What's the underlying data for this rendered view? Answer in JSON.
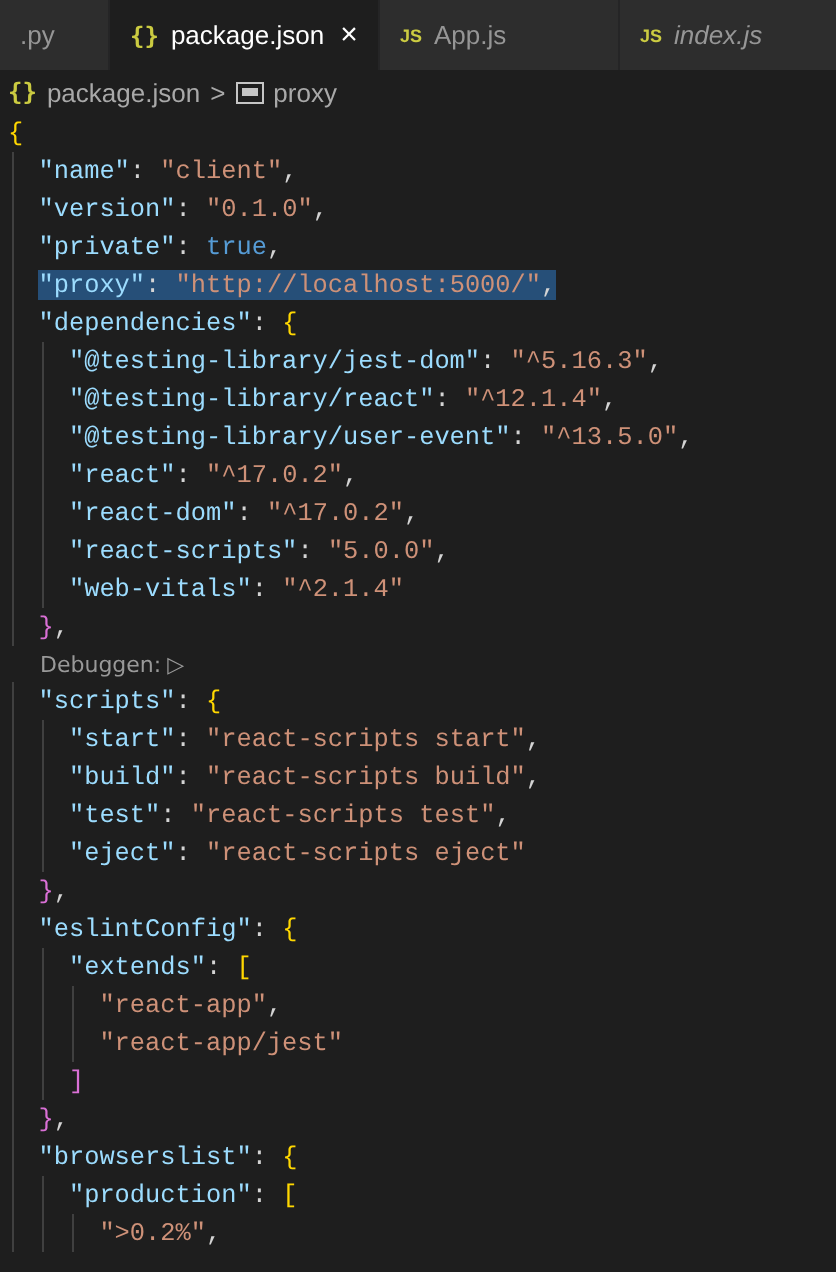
{
  "tabs": [
    {
      "label": ".py",
      "kind": "plain",
      "selected": false,
      "preview": false
    },
    {
      "label": "package.json",
      "kind": "json",
      "icon": "{}",
      "selected": true,
      "preview": false,
      "close": "×"
    },
    {
      "label": "App.js",
      "kind": "js",
      "icon": "JS",
      "selected": false,
      "preview": false
    },
    {
      "label": "index.js",
      "kind": "js",
      "icon": "JS",
      "selected": false,
      "preview": true
    }
  ],
  "breadcrumb": {
    "icon": "{}",
    "file": "package.json",
    "separator": ">",
    "symbol": "proxy"
  },
  "lines": [
    {
      "kind": "code",
      "text": "{",
      "selected": false
    },
    {
      "kind": "code",
      "text": "  \"name\": \"client\",",
      "selected": false
    },
    {
      "kind": "code",
      "text": "  \"version\": \"0.1.0\",",
      "selected": false
    },
    {
      "kind": "code",
      "text": "  \"private\": true,",
      "selected": false
    },
    {
      "kind": "code",
      "text": "  \"proxy\": \"http://localhost:5000/\",",
      "selected": true
    },
    {
      "kind": "code",
      "text": "  \"dependencies\": {",
      "selected": false
    },
    {
      "kind": "code",
      "text": "    \"@testing-library/jest-dom\": \"^5.16.3\",",
      "selected": false
    },
    {
      "kind": "code",
      "text": "    \"@testing-library/react\": \"^12.1.4\",",
      "selected": false
    },
    {
      "kind": "code",
      "text": "    \"@testing-library/user-event\": \"^13.5.0\",",
      "selected": false
    },
    {
      "kind": "code",
      "text": "    \"react\": \"^17.0.2\",",
      "selected": false
    },
    {
      "kind": "code",
      "text": "    \"react-dom\": \"^17.0.2\",",
      "selected": false
    },
    {
      "kind": "code",
      "text": "    \"react-scripts\": \"5.0.0\",",
      "selected": false
    },
    {
      "kind": "code",
      "text": "    \"web-vitals\": \"^2.1.4\"",
      "selected": false
    },
    {
      "kind": "code",
      "text": "  },",
      "selected": false
    },
    {
      "kind": "codelens",
      "text": "Debuggen:",
      "icon": "▷"
    },
    {
      "kind": "code",
      "text": "  \"scripts\": {",
      "selected": false
    },
    {
      "kind": "code",
      "text": "    \"start\": \"react-scripts start\",",
      "selected": false
    },
    {
      "kind": "code",
      "text": "    \"build\": \"react-scripts build\",",
      "selected": false
    },
    {
      "kind": "code",
      "text": "    \"test\": \"react-scripts test\",",
      "selected": false
    },
    {
      "kind": "code",
      "text": "    \"eject\": \"react-scripts eject\"",
      "selected": false
    },
    {
      "kind": "code",
      "text": "  },",
      "selected": false
    },
    {
      "kind": "code",
      "text": "  \"eslintConfig\": {",
      "selected": false
    },
    {
      "kind": "code",
      "text": "    \"extends\": [",
      "selected": false
    },
    {
      "kind": "code",
      "text": "      \"react-app\",",
      "selected": false
    },
    {
      "kind": "code",
      "text": "      \"react-app/jest\"",
      "selected": false
    },
    {
      "kind": "code",
      "text": "    ]",
      "selected": false
    },
    {
      "kind": "code",
      "text": "  },",
      "selected": false
    },
    {
      "kind": "code",
      "text": "  \"browserslist\": {",
      "selected": false
    },
    {
      "kind": "code",
      "text": "    \"production\": [",
      "selected": false
    },
    {
      "kind": "code",
      "text": "      \">0.2%\",",
      "selected": false
    }
  ]
}
